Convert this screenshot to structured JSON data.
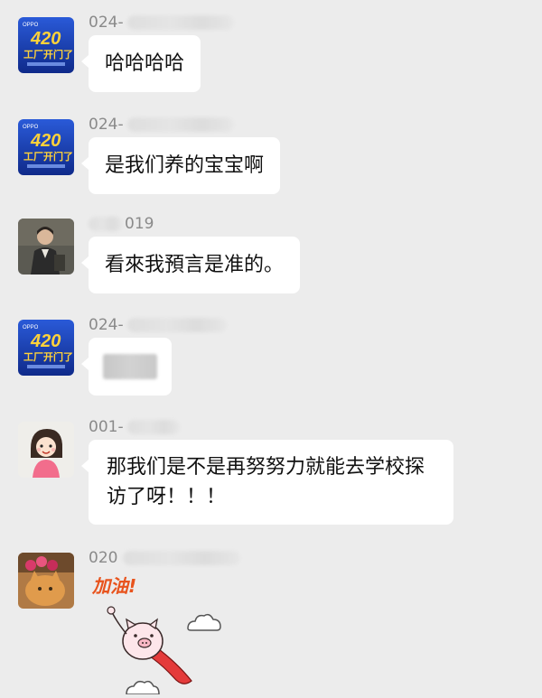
{
  "messages": [
    {
      "sender_prefix": "024-",
      "text": "哈哈哈哈",
      "avatar": "oppo-event-avatar"
    },
    {
      "sender_prefix": "024-",
      "text": "是我们养的宝宝啊",
      "avatar": "oppo-event-avatar"
    },
    {
      "sender_suffix": "019",
      "text": "看來我預言是准的。",
      "avatar": "person-photo-avatar"
    },
    {
      "sender_prefix": "024-",
      "text": "",
      "avatar": "oppo-event-avatar"
    },
    {
      "sender_prefix": "001-",
      "text": "那我们是不是再努努力就能去学校探访了呀！！！",
      "avatar": "cartoon-girl-avatar"
    },
    {
      "sender_prefix": "020",
      "avatar": "cat-photo-avatar",
      "sticker_text": "加油!"
    }
  ],
  "avatar_badge": {
    "brand": "OPPO",
    "headline": "420",
    "sub": "工厂开门了"
  },
  "colors": {
    "background": "#ececec",
    "bubble": "#ffffff",
    "sender_name": "#8a8a8a",
    "sticker_text": "#e8541e"
  }
}
